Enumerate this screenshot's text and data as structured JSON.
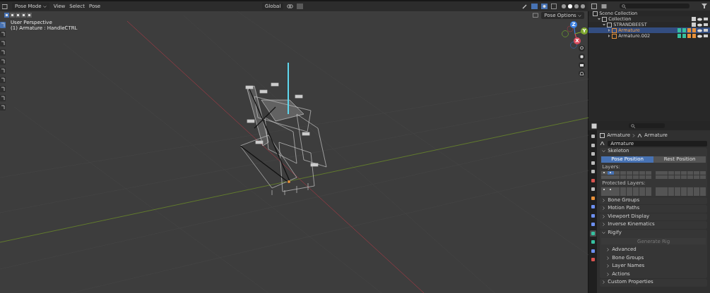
{
  "viewport": {
    "mode": "Pose Mode",
    "menus": [
      "View",
      "Select",
      "Pose"
    ],
    "orientation": "Global",
    "pose_options": "Pose Options",
    "select_modes": [
      {
        "selected": true
      },
      {
        "selected": false
      },
      {
        "selected": false
      },
      {
        "selected": false
      },
      {
        "selected": false
      }
    ],
    "tools": [
      {
        "selected": true
      },
      {
        "selected": false
      },
      {
        "selected": false
      },
      {
        "selected": false
      },
      {
        "selected": false
      },
      {
        "selected": false
      },
      {
        "selected": false
      },
      {
        "selected": false
      },
      {
        "selected": false
      },
      {
        "selected": false
      }
    ],
    "shading_modes": [
      {
        "selected": false
      },
      {
        "selected": true
      },
      {
        "selected": false
      },
      {
        "selected": false
      }
    ],
    "overlay_text": [
      "User Perspective",
      "(1) Armature : HandleCTRL"
    ],
    "gizmo_labels": [
      "Z",
      "Y",
      "X"
    ]
  },
  "outliner": {
    "items": [
      {
        "label": "Scene Collection",
        "selected": false,
        "kind": "scene",
        "children": [
          {
            "label": "Collection",
            "selected": false,
            "expanded": true,
            "kind": "collection",
            "children": [
              {
                "label": "STRANDBEEST",
                "selected": false,
                "expanded": true,
                "kind": "collection",
                "children": [
                  {
                    "label": "Armature",
                    "selected": true,
                    "expanded": false,
                    "kind": "armature"
                  },
                  {
                    "label": "Armature.002",
                    "selected": false,
                    "expanded": false,
                    "kind": "armature"
                  }
                ]
              }
            ]
          }
        ]
      }
    ]
  },
  "properties": {
    "breadcrumb": [
      "Armature",
      "Armature"
    ],
    "name": "Armature",
    "skeleton": {
      "title": "Skeleton",
      "expanded": true,
      "positions": [
        {
          "label": "Pose Position",
          "selected": true
        },
        {
          "label": "Rest Position",
          "selected": false
        }
      ],
      "layers_label": "Layers:",
      "layers": [
        {
          "selected": false,
          "used": true
        },
        {
          "selected": true,
          "used": true
        },
        {
          "selected": false,
          "used": false
        },
        {
          "selected": false,
          "used": false
        },
        {
          "selected": false,
          "used": false
        },
        {
          "selected": false,
          "used": false
        },
        {
          "selected": false,
          "used": false
        },
        {
          "selected": false,
          "used": false
        },
        {
          "selected": false,
          "used": false
        },
        {
          "selected": false,
          "used": false
        },
        {
          "selected": false,
          "used": false
        },
        {
          "selected": false,
          "used": false
        },
        {
          "selected": false,
          "used": false
        },
        {
          "selected": false,
          "used": false
        },
        {
          "selected": false,
          "used": false
        },
        {
          "selected": false,
          "used": false
        },
        {
          "selected": false,
          "used": false
        },
        {
          "selected": false,
          "used": false
        },
        {
          "selected": false,
          "used": false
        },
        {
          "selected": false,
          "used": false
        },
        {
          "selected": false,
          "used": false
        },
        {
          "selected": false,
          "used": false
        },
        {
          "selected": false,
          "used": false
        },
        {
          "selected": false,
          "used": false
        },
        {
          "selected": false,
          "used": false
        },
        {
          "selected": false,
          "used": false
        },
        {
          "selected": false,
          "used": false
        },
        {
          "selected": false,
          "used": false
        },
        {
          "selected": false,
          "used": false
        },
        {
          "selected": false,
          "used": false
        },
        {
          "selected": false,
          "used": false
        },
        {
          "selected": false,
          "used": false
        }
      ],
      "protected_label": "Protected Layers:",
      "protected": [
        {
          "selected": false,
          "used": true
        },
        {
          "selected": false,
          "used": true
        },
        {
          "selected": false,
          "used": false
        },
        {
          "selected": false,
          "used": false
        },
        {
          "selected": false,
          "used": false
        },
        {
          "selected": false,
          "used": false
        },
        {
          "selected": false,
          "used": false
        },
        {
          "selected": false,
          "used": false
        },
        {
          "selected": false,
          "used": false
        },
        {
          "selected": false,
          "used": false
        },
        {
          "selected": false,
          "used": false
        },
        {
          "selected": false,
          "used": false
        },
        {
          "selected": false,
          "used": false
        },
        {
          "selected": false,
          "used": false
        },
        {
          "selected": false,
          "used": false
        },
        {
          "selected": false,
          "used": false
        },
        {
          "selected": false,
          "used": false
        },
        {
          "selected": false,
          "used": false
        },
        {
          "selected": false,
          "used": false
        },
        {
          "selected": false,
          "used": false
        },
        {
          "selected": false,
          "used": false
        },
        {
          "selected": false,
          "used": false
        },
        {
          "selected": false,
          "used": false
        },
        {
          "selected": false,
          "used": false
        },
        {
          "selected": false,
          "used": false
        },
        {
          "selected": false,
          "used": false
        },
        {
          "selected": false,
          "used": false
        },
        {
          "selected": false,
          "used": false
        },
        {
          "selected": false,
          "used": false
        },
        {
          "selected": false,
          "used": false
        },
        {
          "selected": false,
          "used": false
        },
        {
          "selected": false,
          "used": false
        }
      ]
    },
    "panels": [
      {
        "label": "Bone Groups",
        "expanded": false
      },
      {
        "label": "Motion Paths",
        "expanded": false
      },
      {
        "label": "Viewport Display",
        "expanded": false
      },
      {
        "label": "Inverse Kinematics",
        "expanded": false
      },
      {
        "label": "Rigify",
        "expanded": true,
        "button": {
          "label": "Generate Rig",
          "disabled": true
        },
        "children": [
          {
            "label": "Advanced",
            "expanded": false
          },
          {
            "label": "Bone Groups",
            "expanded": false
          },
          {
            "label": "Layer Names",
            "expanded": false
          },
          {
            "label": "Actions",
            "expanded": false
          }
        ]
      },
      {
        "label": "Custom Properties",
        "expanded": false
      }
    ],
    "tabs": [
      {
        "selected": false
      },
      {
        "selected": false
      },
      {
        "selected": false
      },
      {
        "selected": false
      },
      {
        "selected": false
      },
      {
        "selected": false
      },
      {
        "selected": false
      },
      {
        "selected": false
      },
      {
        "selected": false
      },
      {
        "selected": false
      },
      {
        "selected": false
      },
      {
        "selected": true
      },
      {
        "selected": false
      },
      {
        "selected": false
      },
      {
        "selected": false
      }
    ]
  }
}
